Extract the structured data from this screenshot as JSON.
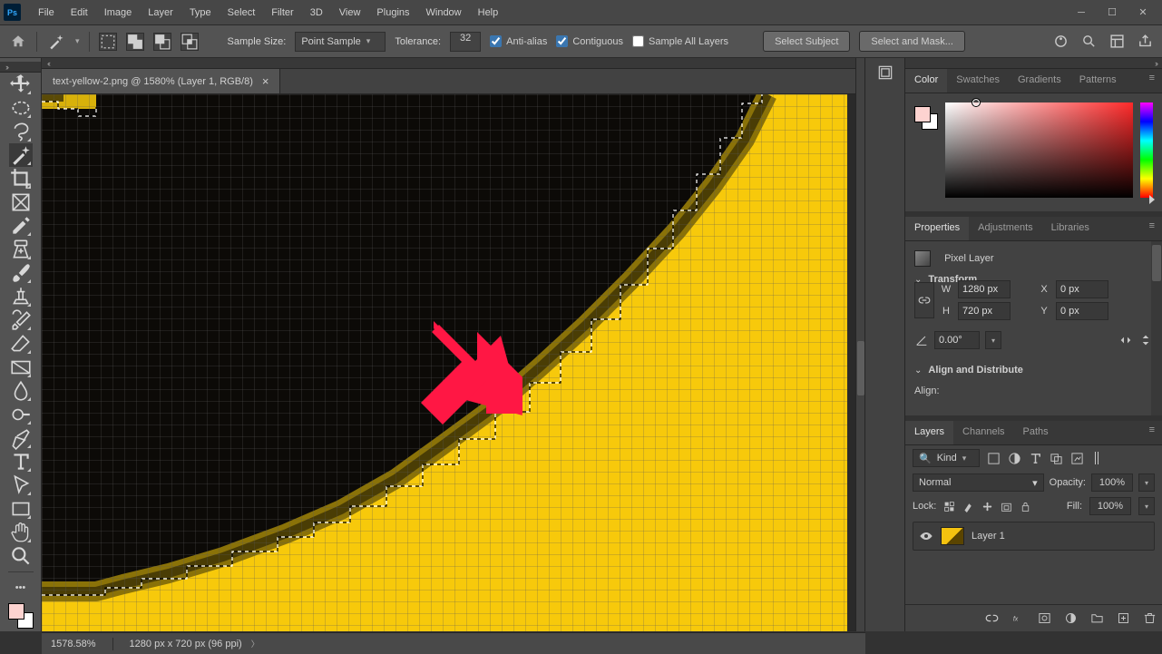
{
  "menu": {
    "items": [
      "File",
      "Edit",
      "Image",
      "Layer",
      "Type",
      "Select",
      "Filter",
      "3D",
      "View",
      "Plugins",
      "Window",
      "Help"
    ]
  },
  "options": {
    "sample_size_label": "Sample Size:",
    "sample_size_value": "Point Sample",
    "tolerance_label": "Tolerance:",
    "tolerance_value": "32",
    "anti_alias": "Anti-alias",
    "contiguous": "Contiguous",
    "sample_all": "Sample All Layers",
    "select_subject": "Select Subject",
    "select_mask": "Select and Mask..."
  },
  "document": {
    "tab_title": "text-yellow-2.png @ 1580% (Layer 1, RGB/8)"
  },
  "panels": {
    "color_tabs": [
      "Color",
      "Swatches",
      "Gradients",
      "Patterns"
    ],
    "props_tabs": [
      "Properties",
      "Adjustments",
      "Libraries"
    ],
    "layers_tabs": [
      "Layers",
      "Channels",
      "Paths"
    ]
  },
  "properties": {
    "pixel_layer": "Pixel Layer",
    "transform": "Transform",
    "W": "1280 px",
    "H": "720 px",
    "X": "0 px",
    "Y": "0 px",
    "angle": "0.00°",
    "align": "Align and Distribute",
    "align_label": "Align:"
  },
  "layers": {
    "kind": "Kind",
    "blend": "Normal",
    "opacity_label": "Opacity:",
    "opacity": "100%",
    "lock_label": "Lock:",
    "fill_label": "Fill:",
    "fill": "100%",
    "layer1": "Layer 1"
  },
  "status": {
    "zoom": "1578.58%",
    "dims": "1280 px x 720 px (96 ppi)"
  }
}
